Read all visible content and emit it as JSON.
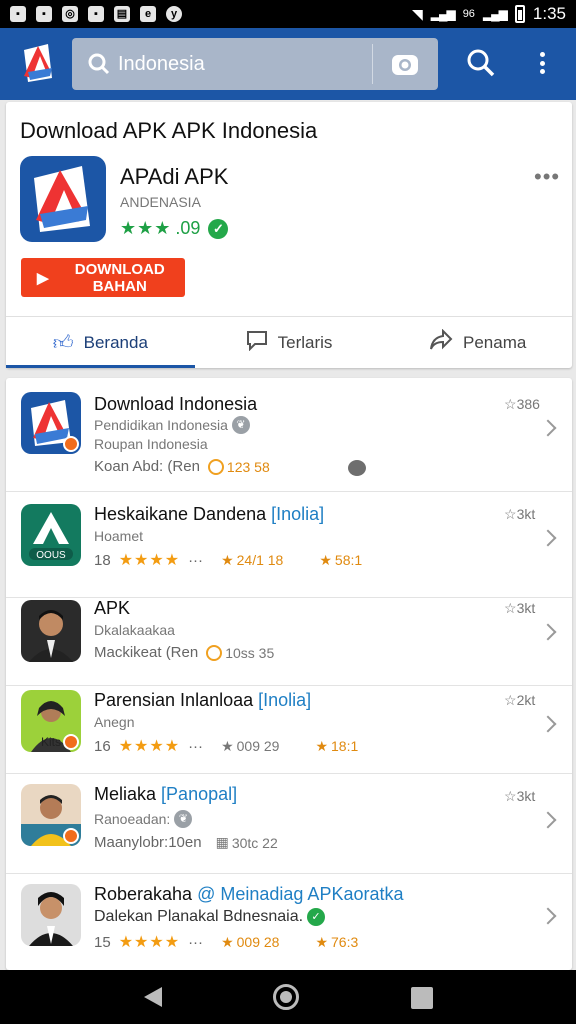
{
  "status_bar": {
    "time": "1:35",
    "signal_label": "96",
    "notification_icons": [
      "photo-icon",
      "photo-icon",
      "instagram-icon",
      "photo-icon",
      "news-icon",
      "messenger-icon",
      "yahoo-icon"
    ]
  },
  "app_bar": {
    "search_value": "Indonesia",
    "colors": {
      "bar": "#1c56a6",
      "search_box": "#a9b6c9"
    }
  },
  "header": {
    "title": "Download APK APK Indonesia",
    "app_name": "APAdi APK",
    "app_sub": "ANDENASIA",
    "rating_value": ".09",
    "download_label": "DOWNLOAD BAHAN",
    "tabs": [
      {
        "label": "Beranda",
        "icon": "thumbs-up-icon"
      },
      {
        "label": "Terlaris",
        "icon": "comment-icon"
      },
      {
        "label": "Penama",
        "icon": "share-icon"
      }
    ]
  },
  "list": [
    {
      "title": "Download Indonesia",
      "tag": "",
      "sub1": "Pendidikan Indonesia",
      "sub2": "Roupan Indonesia",
      "meta_text": "Koan Abd: (Ren",
      "meta_rating": "123 58",
      "count": "386"
    },
    {
      "title": "Heskaikane Dandena",
      "tag": "[Inolia]",
      "sub1": "Hoamet",
      "meta_prefix": "18",
      "meta_rating": "24/1 18",
      "meta_rating2": "58:1",
      "count": "3kt"
    },
    {
      "title": "APK",
      "tag": "",
      "sub1": "Dkalakaakaa",
      "meta_text": "Mackikeat (Ren",
      "meta_rating": "10ss 35",
      "count": "3kt"
    },
    {
      "title": "Parensian Inlanloaa",
      "tag": "[Inolia]",
      "sub1": "Anegn",
      "meta_prefix": "16",
      "meta_rating": "009 29",
      "meta_rating2": "18:1",
      "count": "2kt"
    },
    {
      "title": "Meliaka",
      "tag": "[Panopal]",
      "sub1": "Ranoeadan:",
      "meta_text": "Maanylobr:10en",
      "meta_rating": "30tc 22",
      "count": "3kt"
    },
    {
      "title": "Roberakaha",
      "tag": "@ Meinadiag APKaoratka",
      "sub1": "Dalekan Planakal Bdnesnaia.",
      "meta_prefix": "15",
      "meta_rating": "009 28",
      "meta_rating2": "76:3",
      "count": ""
    }
  ]
}
